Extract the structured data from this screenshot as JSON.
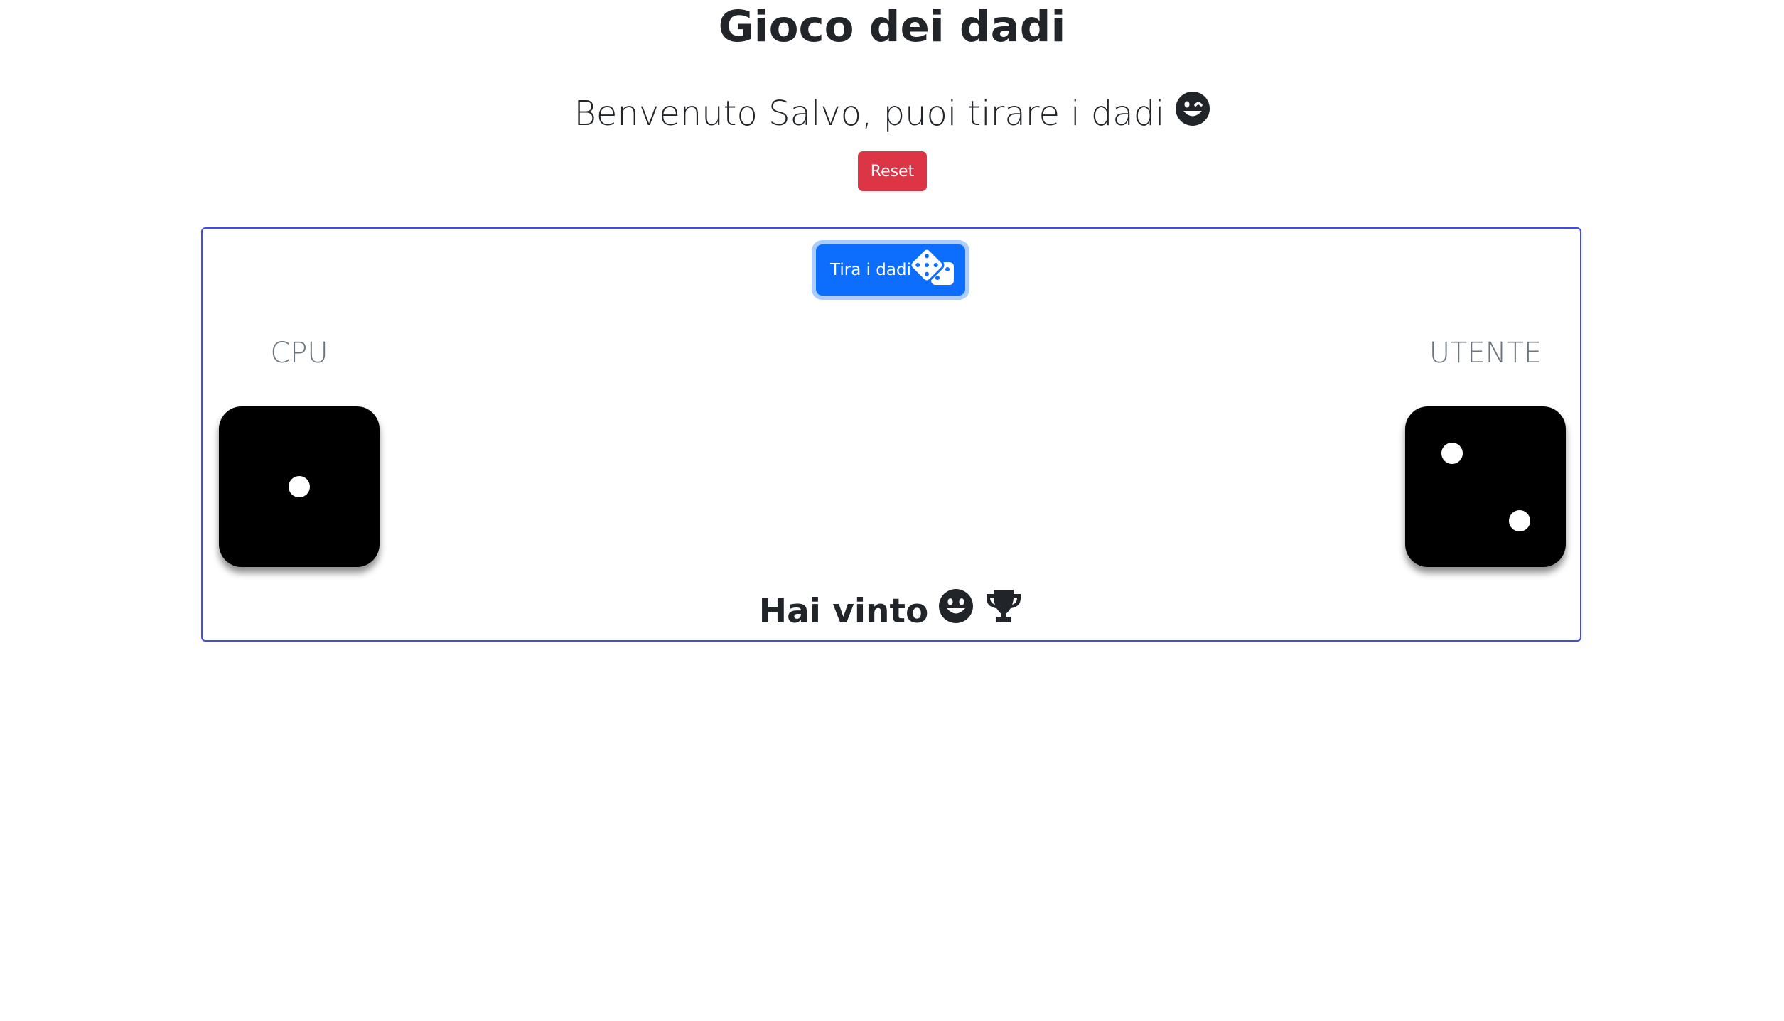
{
  "header": {
    "title": "Gioco dei dadi",
    "welcome_text": "Benvenuto Salvo, puoi tirare i dadi",
    "welcome_icon": "wink-smile-icon"
  },
  "controls": {
    "reset_label": "Reset",
    "roll_label": "Tira i dadi",
    "roll_icon": "dice-icon"
  },
  "game": {
    "cpu_label": "CPU",
    "user_label": "UTENTE",
    "cpu_die_value": 1,
    "user_die_value": 2,
    "result_text": "Hai vinto",
    "result_icons": [
      "smile-icon",
      "trophy-icon"
    ]
  },
  "colors": {
    "reset": "#dc3545",
    "roll": "#0d6efd",
    "box_border": "#3d4bf0",
    "die": "#000000",
    "pip": "#ffffff"
  }
}
